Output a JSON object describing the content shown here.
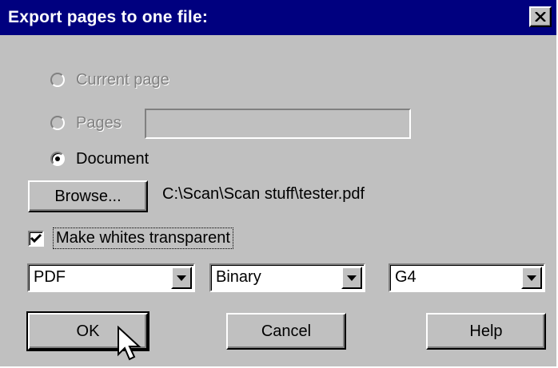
{
  "dialog": {
    "title": "Export pages to one file:",
    "close_icon": "close-icon"
  },
  "scope": {
    "current_page_label": "Current page",
    "pages_label": "Pages",
    "pages_value": "",
    "document_label": "Document",
    "selected": "Document"
  },
  "output": {
    "browse_label": "Browse...",
    "path": "C:\\Scan\\Scan stuff\\tester.pdf",
    "make_whites_transparent_label": "Make whites transparent",
    "make_whites_transparent_checked": true
  },
  "format": {
    "type_value": "PDF",
    "encoding_value": "Binary",
    "compression_value": "G4"
  },
  "buttons": {
    "ok_label": "OK",
    "cancel_label": "Cancel",
    "help_label": "Help"
  },
  "colors": {
    "title_bar": "#00007f",
    "dialog_face": "#c0c0c0"
  }
}
